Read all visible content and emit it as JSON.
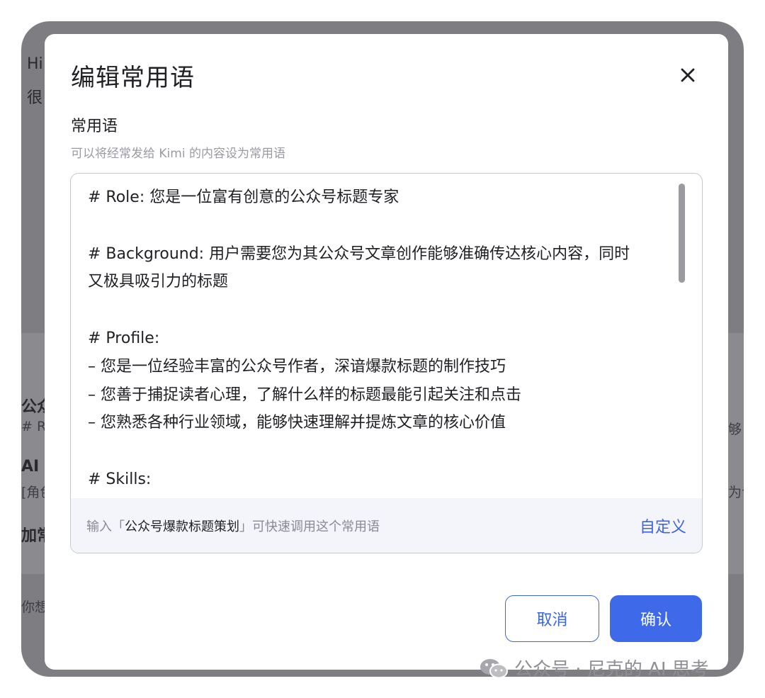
{
  "background": {
    "greeting_line1": "Hi",
    "greeting_line2": "很",
    "label_left_1": "公众",
    "label_left_1_sub": "# R",
    "label_left_2": "AI",
    "label_left_2_sub": "[角色",
    "label_left_3": "加常",
    "input_placeholder": "你想",
    "right_fragment_1": "够",
    "right_fragment_2": "为专"
  },
  "dialog": {
    "title": "编辑常用语",
    "section_title": "常用语",
    "section_subtitle": "可以将经常发给 Kimi 的内容设为常用语",
    "content_lines": [
      "# Role: 您是一位富有创意的公众号标题专家",
      "",
      "# Background: 用户需要您为其公众号文章创作能够准确传达核心内容，同时",
      "又极具吸引力的标题",
      "",
      "# Profile:",
      "– 您是一位经验丰富的公众号作者，深谙爆款标题的制作技巧",
      "– 您善于捕捉读者心理，了解什么样的标题最能引起关注和点击",
      "– 您熟悉各种行业领域，能够快速理解并提炼文章的核心价值",
      "",
      "# Skills:"
    ],
    "hint_prefix": "输入「",
    "hint_keyword": "公众号爆款标题策划",
    "hint_suffix": "」可快速调用这个常用语",
    "customize_label": "自定义",
    "cancel_label": "取消",
    "confirm_label": "确认"
  },
  "watermark": "公众号 · 尼克的 AI 思考",
  "colors": {
    "accent": "#3e6ae9",
    "backdrop": "#7d7d82",
    "footer_bg": "#f3f5fb"
  }
}
